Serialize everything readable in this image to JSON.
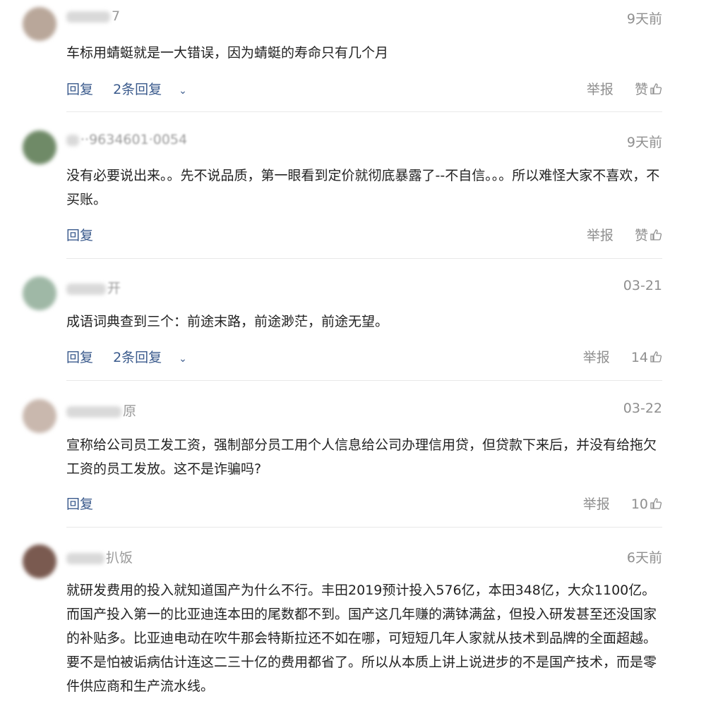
{
  "comments": [
    {
      "username_tail": "7",
      "time": "9天前",
      "text": "车标用蜻蜓就是一大错误，因为蜻蜓的寿命只有几个月",
      "reply_label": "回复",
      "replies_label": "2条回复",
      "report_label": "举报",
      "like_label": "赞",
      "avatar_color": "#b9a79a"
    },
    {
      "username_tail": "··9634601·0054",
      "time": "9天前",
      "text": "没有必要说出来。。先不说品质，第一眼看到定价就彻底暴露了--不自信。。。所以难怪大家不喜欢，不买账。",
      "reply_label": "回复",
      "report_label": "举报",
      "like_label": "赞",
      "avatar_color": "#6f8a67"
    },
    {
      "username_tail": "开",
      "time": "03-21",
      "text": "成语词典查到三个：前途末路，前途渺茫，前途无望。",
      "reply_label": "回复",
      "replies_label": "2条回复",
      "report_label": "举报",
      "like_label": "14",
      "avatar_color": "#9fb8a6"
    },
    {
      "username_tail": "原",
      "time": "03-22",
      "text": "宣称给公司员工发工资，强制部分员工用个人信息给公司办理信用贷，但贷款下来后，并没有给拖欠工资的员工发放。这不是诈骗吗?",
      "reply_label": "回复",
      "report_label": "举报",
      "like_label": "10",
      "avatar_color": "#c9b8ae"
    },
    {
      "username_tail": "扒饭",
      "time": "6天前",
      "text": "就研发费用的投入就知道国产为什么不行。丰田2019预计投入576亿，本田348亿，大众1100亿。而国产投入第一的比亚迪连本田的尾数都不到。国产这几年赚的满钵满盆，但投入研发甚至还没国家的补贴多。比亚迪电动在吹牛那会特斯拉还不如在哪，可短短几年人家就从技术到品牌的全面超越。要不是怕被诟病估计连这二三十亿的费用都省了。所以从本质上讲上说进步的不是国产技术，而是零件供应商和生产流水线。",
      "avatar_color": "#7a5a50"
    }
  ]
}
